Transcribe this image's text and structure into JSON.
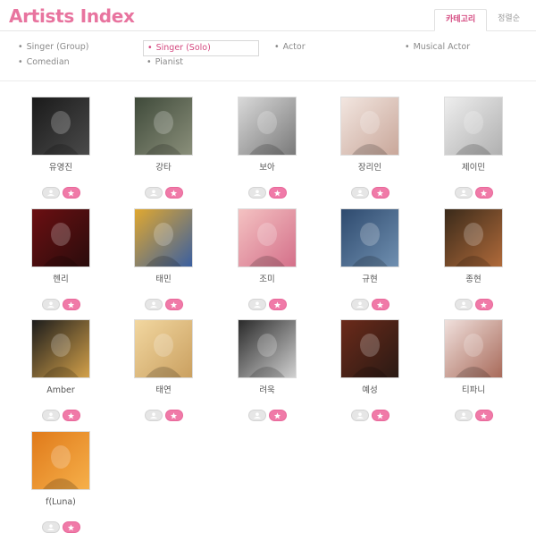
{
  "header": {
    "title": "Artists Index",
    "tabs": [
      {
        "label": "카테고리",
        "active": true
      },
      {
        "label": "정렬순",
        "active": false
      }
    ]
  },
  "categories": [
    {
      "label": "Singer (Group)",
      "selected": false
    },
    {
      "label": "Singer (Solo)",
      "selected": true
    },
    {
      "label": "Actor",
      "selected": false
    },
    {
      "label": "Musical Actor",
      "selected": false
    },
    {
      "label": "Comedian",
      "selected": false
    },
    {
      "label": "Pianist",
      "selected": false
    }
  ],
  "bullet": "•",
  "colors": {
    "accent": "#e8749f",
    "selected_text": "#d4487f",
    "like_button": "#f07aa8",
    "inactive_button": "#e6e6e6"
  },
  "artists": [
    {
      "name": "유영진",
      "colors": [
        "#1a1a1a",
        "#4a4a4a"
      ]
    },
    {
      "name": "강타",
      "colors": [
        "#3f4a3a",
        "#8a8f7a"
      ]
    },
    {
      "name": "보아",
      "colors": [
        "#d9d9d9",
        "#7a7a7a"
      ]
    },
    {
      "name": "장리인",
      "colors": [
        "#f2e6e0",
        "#c9a79a"
      ]
    },
    {
      "name": "제이민",
      "colors": [
        "#eeeeee",
        "#b0b0b0"
      ]
    },
    {
      "name": "헨리",
      "colors": [
        "#6b0f12",
        "#2a0c0c"
      ]
    },
    {
      "name": "태민",
      "colors": [
        "#e0a830",
        "#3a5fa0"
      ]
    },
    {
      "name": "조미",
      "colors": [
        "#f4c2c2",
        "#d4708a"
      ]
    },
    {
      "name": "규현",
      "colors": [
        "#2e4a6e",
        "#6f8fb0"
      ]
    },
    {
      "name": "종현",
      "colors": [
        "#3a2a1a",
        "#b06a3a"
      ]
    },
    {
      "name": "Amber",
      "colors": [
        "#1c1c1c",
        "#d3a14a"
      ]
    },
    {
      "name": "태연",
      "colors": [
        "#f2d7a0",
        "#caa060"
      ]
    },
    {
      "name": "려욱",
      "colors": [
        "#2a2a2a",
        "#d0d0d0"
      ]
    },
    {
      "name": "예성",
      "colors": [
        "#6b2a1a",
        "#2a1a14"
      ]
    },
    {
      "name": "티파니",
      "colors": [
        "#f0e0dc",
        "#a86a5a"
      ]
    },
    {
      "name": "f(Luna)",
      "colors": [
        "#e07a1a",
        "#f6b04a"
      ]
    }
  ]
}
